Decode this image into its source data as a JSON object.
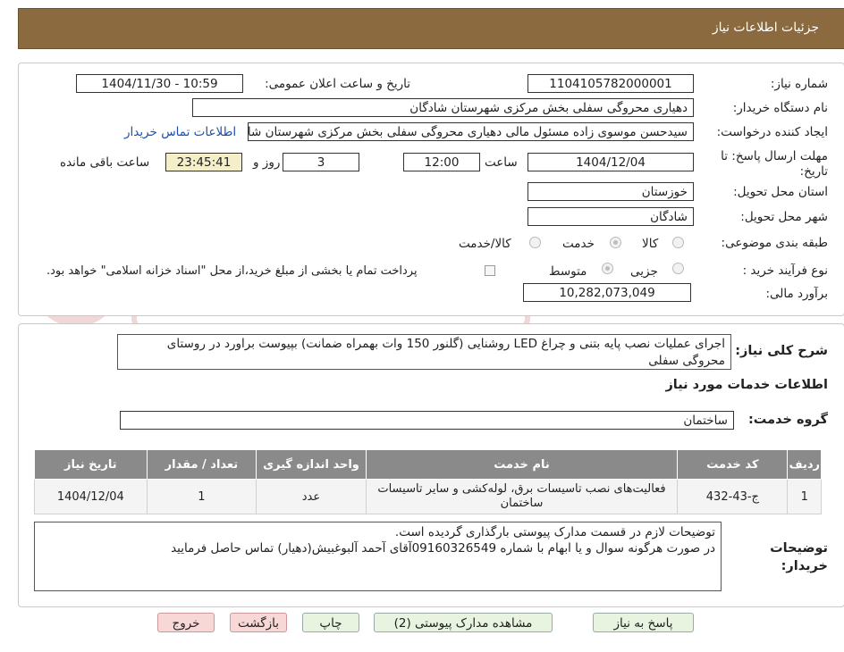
{
  "header": {
    "title": "جزئیات اطلاعات نیاز"
  },
  "form": {
    "need_number_label": "شماره نیاز:",
    "need_number": "1104105782000001",
    "announce_label": "تاریخ و ساعت اعلان عمومی:",
    "announce_value": "1404/11/30 - 10:59",
    "buyer_org_label": "نام دستگاه خریدار:",
    "buyer_org": "دهیاری محروگی سفلی بخش مرکزی شهرستان شادگان",
    "requester_label": "ایجاد کننده درخواست:",
    "requester": "سیدحسن موسوی زاده مسئول مالی دهیاری محروگی سفلی بخش مرکزی شهرستان شادگان",
    "contact_link": "اطلاعات تماس خریدار",
    "deadline_label": "مهلت ارسال پاسخ: تا تاریخ:",
    "deadline_date": "1404/12/04",
    "time_label": "ساعت",
    "deadline_time": "12:00",
    "days_value": "3",
    "days_label": "روز و",
    "remaining_time": "23:45:41",
    "remaining_label": "ساعت باقی مانده",
    "province_label": "استان محل تحویل:",
    "province": "خوزستان",
    "city_label": "شهر محل تحویل:",
    "city": "شادگان",
    "category_label": "طبقه بندی موضوعی:",
    "category_options": [
      "کالا",
      "خدمت",
      "کالا/خدمت"
    ],
    "category_selected": "خدمت",
    "process_label": "نوع فرآیند خرید :",
    "process_options": [
      "جزیی",
      "متوسط"
    ],
    "process_selected": "متوسط",
    "payment_note": "پرداخت تمام یا بخشی از مبلغ خرید،از محل \"اسناد خزانه اسلامی\" خواهد بود.",
    "budget_label": "برآورد مالی:",
    "budget": "10,282,073,049"
  },
  "description": {
    "label": "شرح کلی نیاز:",
    "text": "اجرای عملیات نصب پایه بتنی و چراغ LED روشنایی (گلنور 150 وات بهمراه ضمانت) بپیوست براورد در روستای محروگی سفلی"
  },
  "services": {
    "section_title": "اطلاعات خدمات مورد نیاز",
    "group_label": "گروه خدمت:",
    "group_value": "ساختمان",
    "columns": [
      "ردیف",
      "کد خدمت",
      "نام خدمت",
      "واحد اندازه گیری",
      "تعداد / مقدار",
      "تاریخ نیاز"
    ],
    "rows": [
      [
        "1",
        "ج-43-432",
        "فعالیت‌های نصب تاسیسات برق، لوله‌کشی و سایر تاسیسات ساختمان",
        "عدد",
        "1",
        "1404/12/04"
      ]
    ]
  },
  "buyer_notes": {
    "label": "توضیحات خریدار:",
    "line1": "توضیحات لازم در قسمت مدارک پیوستی بارگذاری گردیده است.",
    "line2": "در صورت هرگونه سوال و یا ابهام با شماره 09160326549آقای آحمد آلبوغبیش(دهیار) تماس حاصل فرمایید"
  },
  "buttons": {
    "reply": "پاسخ به نیاز",
    "attachments": "مشاهده مدارک پیوستی (2)",
    "print": "چاپ",
    "back": "بازگشت",
    "exit": "خروج"
  },
  "colors": {
    "header_bg": "#8a6a3e",
    "table_header_bg": "#8a8a8a",
    "link": "#1a4fb3",
    "highlight": "#f4efc9"
  }
}
